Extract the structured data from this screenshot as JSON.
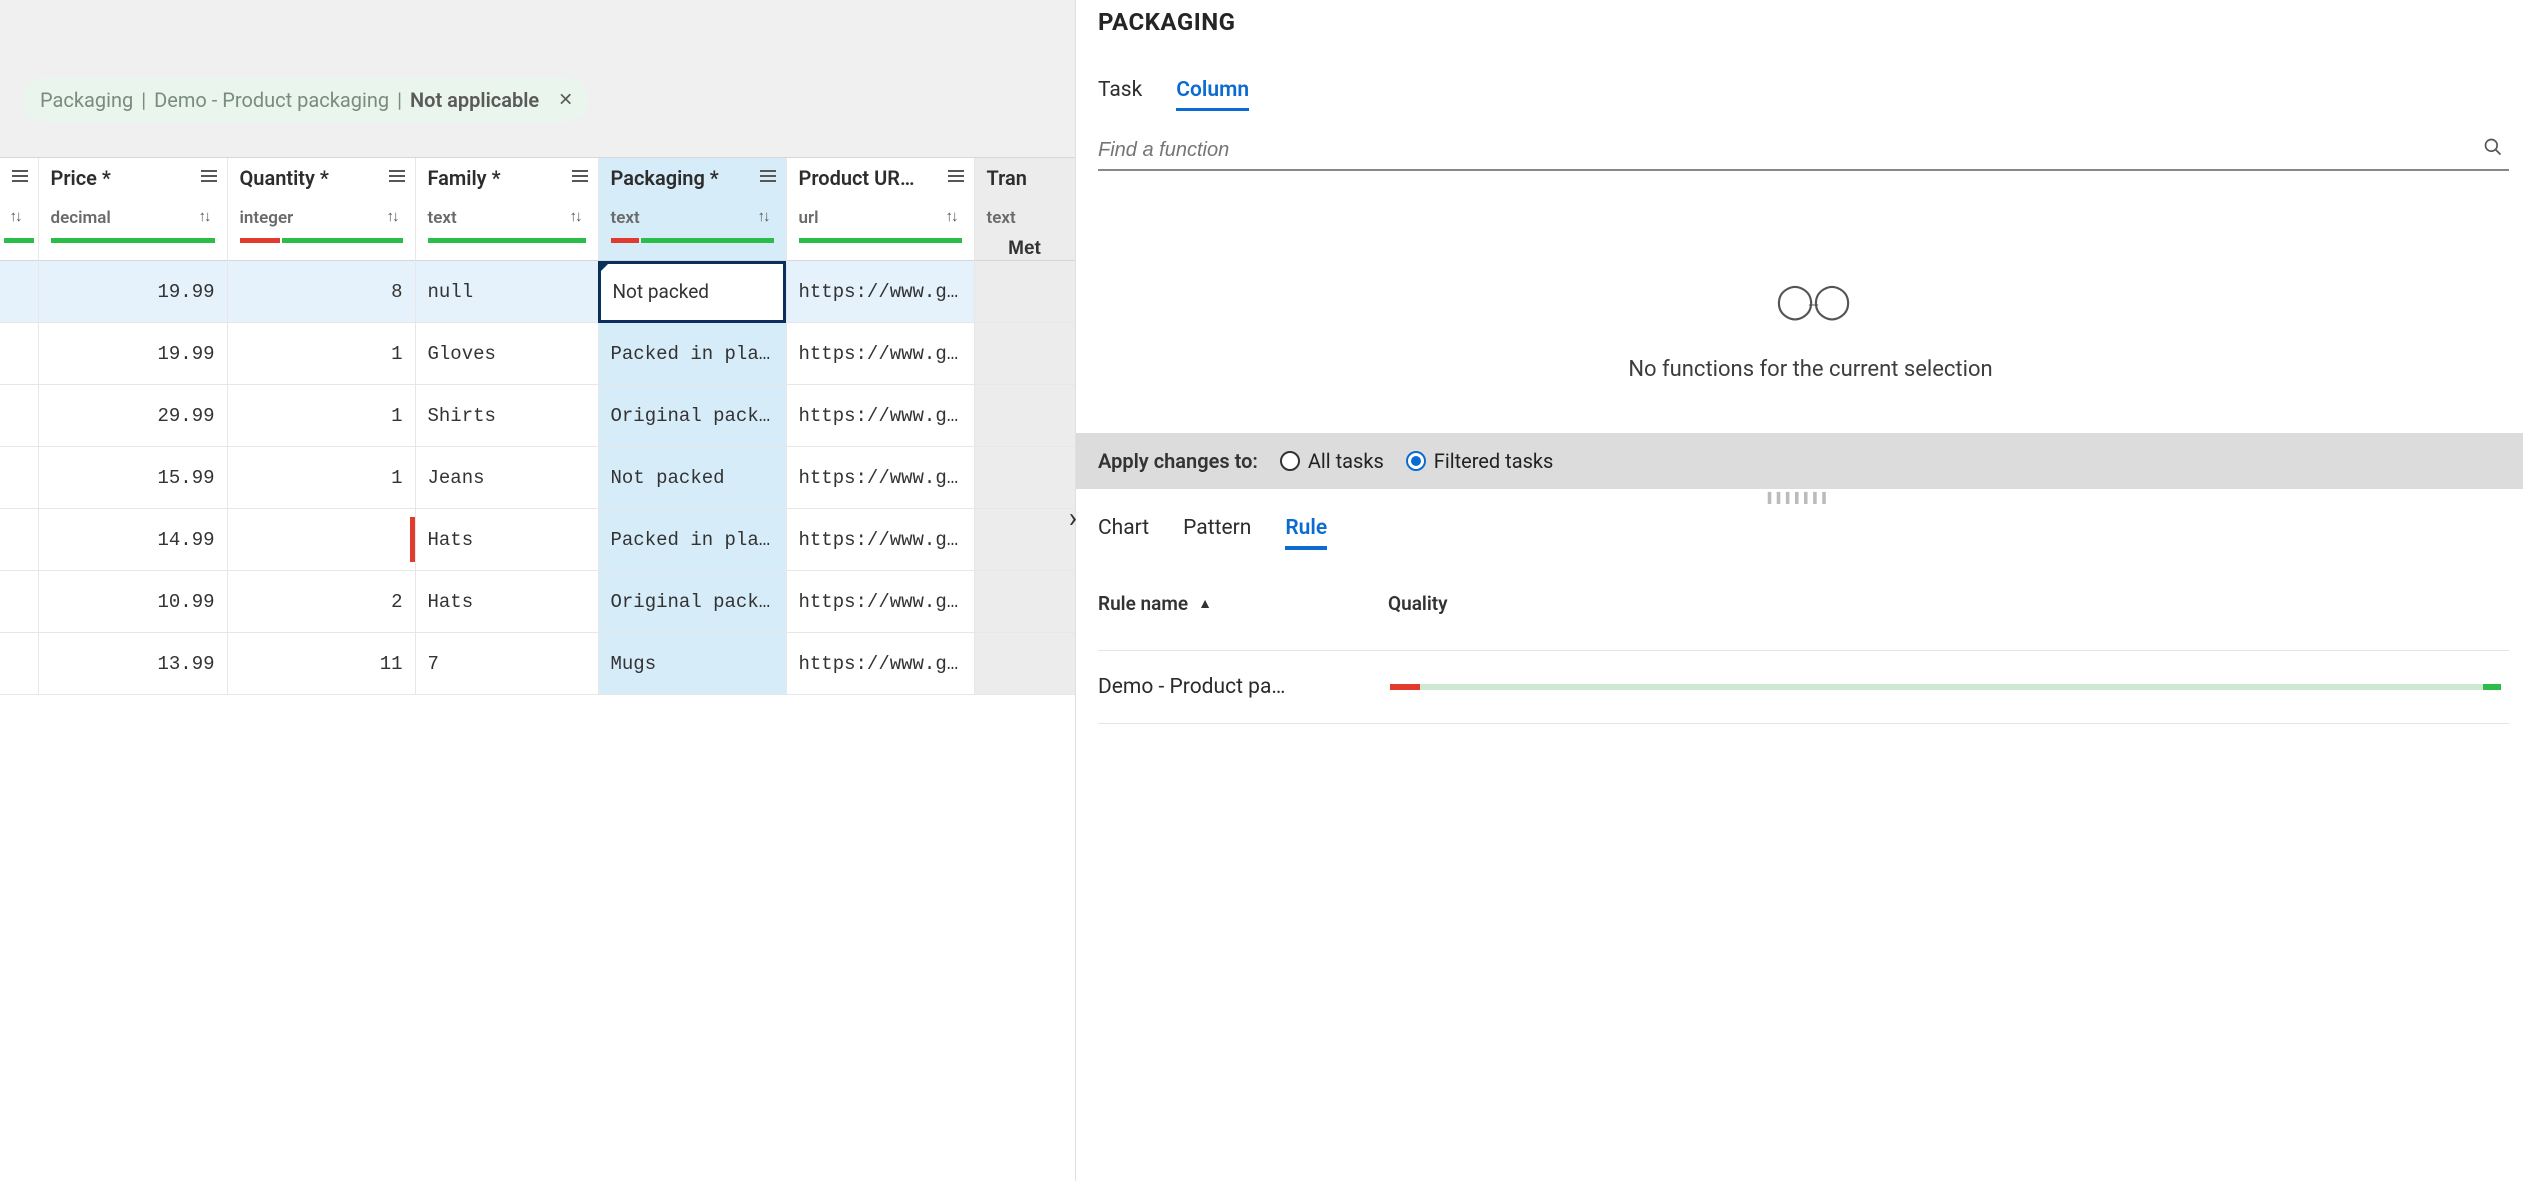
{
  "chip": {
    "part1": "Packaging",
    "part2": "Demo - Product packaging",
    "part3": "Not applicable",
    "sep": "|"
  },
  "columns": [
    {
      "title": "",
      "type": ""
    },
    {
      "title": "Price *",
      "type": "decimal"
    },
    {
      "title": "Quantity *",
      "type": "integer"
    },
    {
      "title": "Family *",
      "type": "text"
    },
    {
      "title": "Packaging *",
      "type": "text"
    },
    {
      "title": "Product UR…",
      "type": "url"
    },
    {
      "title": "Tran",
      "type": "text"
    }
  ],
  "meta_cell": "Met",
  "rows": [
    {
      "price": "19.99",
      "qty": "8",
      "family": "null",
      "pack": "Not packed",
      "url": "https://www.goo…"
    },
    {
      "price": "19.99",
      "qty": "1",
      "family": "Gloves",
      "pack": "Packed in plast…",
      "url": "https://www.goo…"
    },
    {
      "price": "29.99",
      "qty": "1",
      "family": "Shirts",
      "pack": "Original packag…",
      "url": "https://www.goo…"
    },
    {
      "price": "15.99",
      "qty": "1",
      "family": "Jeans",
      "pack": "Not packed",
      "url": "https://www.goo…"
    },
    {
      "price": "14.99",
      "qty": "",
      "family": "Hats",
      "pack": "Packed in plast…",
      "url": "https://www.goo…",
      "qty_invalid": true
    },
    {
      "price": "10.99",
      "qty": "2",
      "family": "Hats",
      "pack": "Original packag…",
      "url": "https://www.goo…"
    },
    {
      "price": "13.99",
      "qty": "11",
      "family": "7",
      "pack": "Mugs",
      "url": "https://www.goo…"
    }
  ],
  "side": {
    "title": "PACKAGING",
    "tabs1": [
      "Task",
      "Column"
    ],
    "search_placeholder": "Find a function",
    "empty_text": "No functions for the current selection",
    "apply_label": "Apply changes to:",
    "apply_options": [
      "All tasks",
      "Filtered tasks"
    ],
    "apply_selected": 1,
    "tabs2": [
      "Chart",
      "Pattern",
      "Rule"
    ],
    "rule_header": {
      "name_col": "Rule name",
      "quality_col": "Quality"
    },
    "rule_row": {
      "name": "Demo - Product pa…"
    }
  }
}
